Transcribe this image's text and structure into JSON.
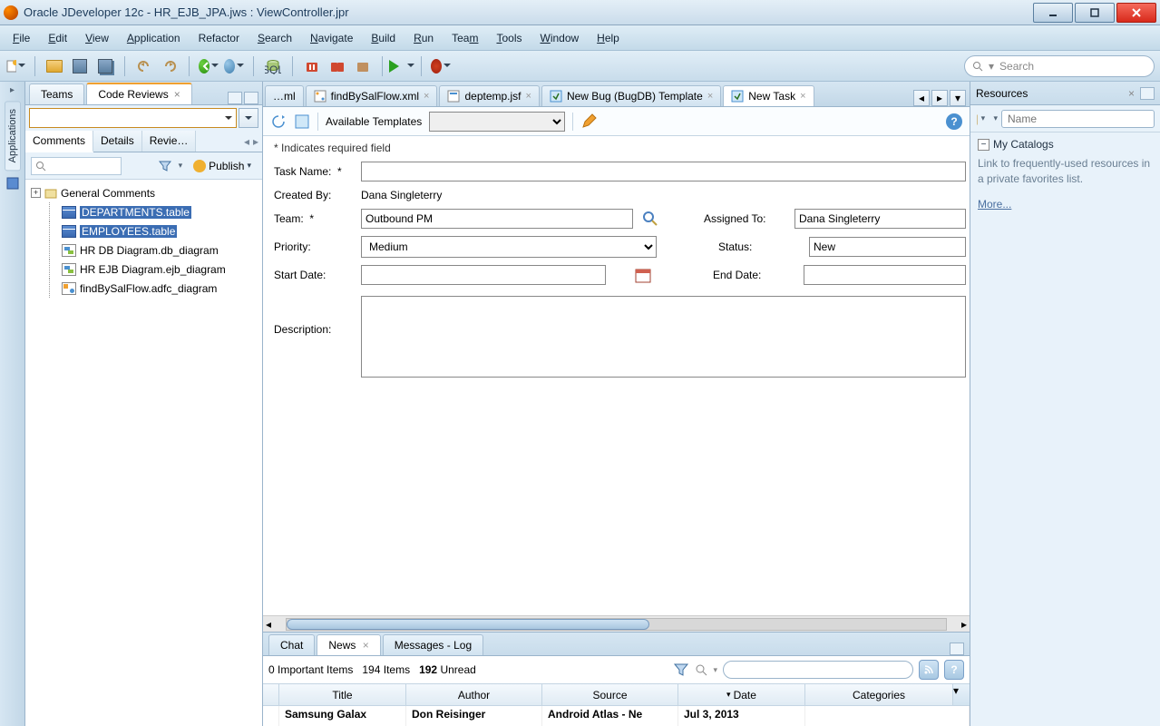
{
  "title": "Oracle JDeveloper 12c - HR_EJB_JPA.jws : ViewController.jpr",
  "menu": [
    "File",
    "Edit",
    "View",
    "Application",
    "Refactor",
    "Search",
    "Navigate",
    "Build",
    "Run",
    "Team",
    "Tools",
    "Window",
    "Help"
  ],
  "search_placeholder": "Search",
  "left": {
    "tabs": {
      "teams": "Teams",
      "code_reviews": "Code Reviews"
    },
    "subtabs": {
      "comments": "Comments",
      "details": "Details",
      "review": "Revie…"
    },
    "publish": "Publish",
    "tree": {
      "root": "General Comments",
      "items": [
        {
          "label": "DEPARTMENTS.table",
          "selected": true,
          "icon": "table"
        },
        {
          "label": "EMPLOYEES.table",
          "selected": true,
          "icon": "table"
        },
        {
          "label": "HR DB Diagram.db_diagram",
          "selected": false,
          "icon": "diagram"
        },
        {
          "label": "HR EJB Diagram.ejb_diagram",
          "selected": false,
          "icon": "diagram"
        },
        {
          "label": "findBySalFlow.adfc_diagram",
          "selected": false,
          "icon": "flow"
        }
      ]
    }
  },
  "rail": {
    "applications": "Applications"
  },
  "editor_tabs": [
    {
      "label": "…ml",
      "active": false
    },
    {
      "label": "findBySalFlow.xml",
      "active": false
    },
    {
      "label": "deptemp.jsf",
      "active": false
    },
    {
      "label": "New Bug (BugDB) Template",
      "active": false
    },
    {
      "label": "New Task",
      "active": true
    }
  ],
  "form": {
    "templates_label": "Available Templates",
    "required_note": "* Indicates required field",
    "task_name_label": "Task Name:",
    "task_name_req": "*",
    "task_name": "",
    "created_by_label": "Created By:",
    "created_by": "Dana Singleterry",
    "team_label": "Team:",
    "team_req": "*",
    "team": "Outbound PM",
    "assigned_label": "Assigned To:",
    "assigned": "Dana Singleterry",
    "priority_label": "Priority:",
    "priority": "Medium",
    "status_label": "Status:",
    "status": "New",
    "start_label": "Start Date:",
    "start": "",
    "end_label": "End Date:",
    "end": "",
    "desc_label": "Description:",
    "desc": ""
  },
  "bottom": {
    "tabs": {
      "chat": "Chat",
      "news": "News",
      "messages": "Messages - Log"
    },
    "status": {
      "important": "0 Important Items",
      "items": "194 Items",
      "unread_count": "192",
      "unread_label": "Unread"
    },
    "columns": [
      "Title",
      "Author",
      "Source",
      "Date",
      "Categories"
    ],
    "row": {
      "title": "Samsung Galax",
      "author": "Don Reisinger",
      "source": "Android Atlas - Ne",
      "date": "Jul 3, 2013",
      "categories": ""
    }
  },
  "right": {
    "title": "Resources",
    "name_placeholder": "Name",
    "catalogs": "My Catalogs",
    "desc": "Link to frequently-used resources in a private favorites list.",
    "more": "More..."
  }
}
